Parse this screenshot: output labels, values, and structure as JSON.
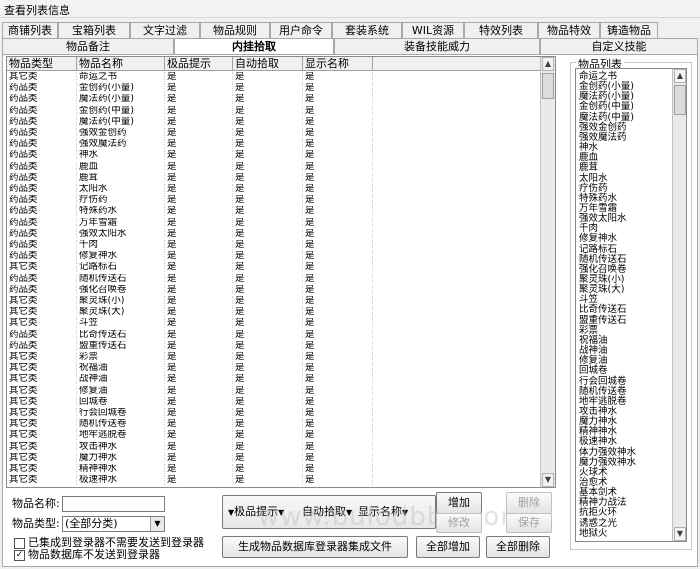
{
  "window": {
    "title": "查看列表信息"
  },
  "tabs": {
    "row1": [
      "商铺列表",
      "宝箱列表",
      "文字过滤",
      "物品规则",
      "用户命令",
      "套装系统",
      "WIL资源",
      "特效列表",
      "物品特效",
      "铸造物品"
    ],
    "row2": [
      "物品备注",
      "内挂拾取",
      "装备技能威力",
      "自定义技能"
    ],
    "active": "内挂拾取"
  },
  "grid": {
    "columns": [
      "物品类型",
      "物品名称",
      "极品提示",
      "自动拾取",
      "显示名称"
    ],
    "rows": [
      [
        "其它类",
        "命运之书",
        "是",
        "是",
        "是"
      ],
      [
        "药品类",
        "金创药(小量)",
        "是",
        "是",
        "是"
      ],
      [
        "药品类",
        "魔法药(小量)",
        "是",
        "是",
        "是"
      ],
      [
        "药品类",
        "金创药(中量)",
        "是",
        "是",
        "是"
      ],
      [
        "药品类",
        "魔法药(中量)",
        "是",
        "是",
        "是"
      ],
      [
        "药品类",
        "强效金创药",
        "是",
        "是",
        "是"
      ],
      [
        "药品类",
        "强效魔法药",
        "是",
        "是",
        "是"
      ],
      [
        "药品类",
        "神水",
        "是",
        "是",
        "是"
      ],
      [
        "药品类",
        "鹿血",
        "是",
        "是",
        "是"
      ],
      [
        "药品类",
        "鹿茸",
        "是",
        "是",
        "是"
      ],
      [
        "药品类",
        "太阳水",
        "是",
        "是",
        "是"
      ],
      [
        "药品类",
        "疗伤药",
        "是",
        "是",
        "是"
      ],
      [
        "药品类",
        "特殊药水",
        "是",
        "是",
        "是"
      ],
      [
        "药品类",
        "万年雪霜",
        "是",
        "是",
        "是"
      ],
      [
        "药品类",
        "强效太阳水",
        "是",
        "是",
        "是"
      ],
      [
        "药品类",
        "千肉",
        "是",
        "是",
        "是"
      ],
      [
        "药品类",
        "修复神水",
        "是",
        "是",
        "是"
      ],
      [
        "其它类",
        "记路标石",
        "是",
        "是",
        "是"
      ],
      [
        "药品类",
        "随机传送石",
        "是",
        "是",
        "是"
      ],
      [
        "药品类",
        "强化召唤卷",
        "是",
        "是",
        "是"
      ],
      [
        "其它类",
        "聚灵珠(小)",
        "是",
        "是",
        "是"
      ],
      [
        "其它类",
        "聚灵珠(大)",
        "是",
        "是",
        "是"
      ],
      [
        "其它类",
        "斗笠",
        "是",
        "是",
        "是"
      ],
      [
        "药品类",
        "比奇传送石",
        "是",
        "是",
        "是"
      ],
      [
        "药品类",
        "盟重传送石",
        "是",
        "是",
        "是"
      ],
      [
        "其它类",
        "彩票",
        "是",
        "是",
        "是"
      ],
      [
        "其它类",
        "祝福油",
        "是",
        "是",
        "是"
      ],
      [
        "其它类",
        "战神油",
        "是",
        "是",
        "是"
      ],
      [
        "其它类",
        "修复油",
        "是",
        "是",
        "是"
      ],
      [
        "其它类",
        "回城卷",
        "是",
        "是",
        "是"
      ],
      [
        "其它类",
        "行会回城卷",
        "是",
        "是",
        "是"
      ],
      [
        "其它类",
        "随机传送卷",
        "是",
        "是",
        "是"
      ],
      [
        "其它类",
        "地牢逃脱卷",
        "是",
        "是",
        "是"
      ],
      [
        "其它类",
        "攻击神水",
        "是",
        "是",
        "是"
      ],
      [
        "其它类",
        "魔力神水",
        "是",
        "是",
        "是"
      ],
      [
        "其它类",
        "精神神水",
        "是",
        "是",
        "是"
      ],
      [
        "其它类",
        "极速神水",
        "是",
        "是",
        "是"
      ]
    ]
  },
  "item_list": {
    "title": "物品列表",
    "items": [
      "命运之书",
      "金创药(小量)",
      "魔法药(小量)",
      "金创药(中量)",
      "魔法药(中量)",
      "强效金创药",
      "强效魔法药",
      "神水",
      "鹿血",
      "鹿茸",
      "太阳水",
      "疗伤药",
      "特殊药水",
      "万年雪霜",
      "强效太阳水",
      "千肉",
      "修复神水",
      "记路标石",
      "随机传送石",
      "强化召唤卷",
      "聚灵珠(小)",
      "聚灵珠(大)",
      "斗笠",
      "比奇传送石",
      "盟重传送石",
      "彩票",
      "祝福油",
      "战神油",
      "修复油",
      "回城卷",
      "行会回城卷",
      "随机传送卷",
      "地牢逃脱卷",
      "攻击神水",
      "魔力神水",
      "精神神水",
      "极速神水",
      "体力强效神水",
      "魔力强效神水",
      "火球术",
      "治愈术",
      "基本剑术",
      "精神力战法",
      "抗拒火环",
      "诱惑之光",
      "地狱火"
    ]
  },
  "form": {
    "name_label": "物品名称:",
    "name_value": "",
    "type_label": "物品类型:",
    "type_value": "(全部分类)",
    "check1_label": "已集成到登录器不需要发送到登录器",
    "check1_checked": false,
    "check2_label": "物品数据库不发送到登录器",
    "check2_checked": true
  },
  "options": {
    "opt1": "极品提示",
    "opt2": "自动拾取",
    "opt3": "显示名称"
  },
  "buttons": {
    "add": "增加",
    "delete": "删除",
    "modify": "修改",
    "save": "保存",
    "generate": "生成物品数据库登录器集成文件",
    "add_all": "全部增加",
    "delete_all": "全部删除"
  },
  "watermark": "www.bulodbbs.com"
}
